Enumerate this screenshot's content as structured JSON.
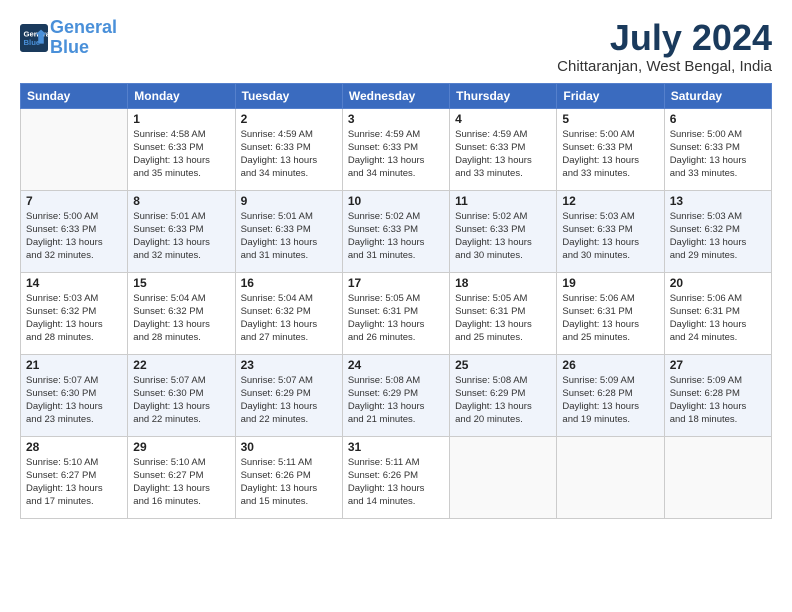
{
  "header": {
    "logo_line1": "General",
    "logo_line2": "Blue",
    "title": "July 2024",
    "location": "Chittaranjan, West Bengal, India"
  },
  "days_of_week": [
    "Sunday",
    "Monday",
    "Tuesday",
    "Wednesday",
    "Thursday",
    "Friday",
    "Saturday"
  ],
  "weeks": [
    [
      {
        "day": "",
        "info": ""
      },
      {
        "day": "1",
        "info": "Sunrise: 4:58 AM\nSunset: 6:33 PM\nDaylight: 13 hours\nand 35 minutes."
      },
      {
        "day": "2",
        "info": "Sunrise: 4:59 AM\nSunset: 6:33 PM\nDaylight: 13 hours\nand 34 minutes."
      },
      {
        "day": "3",
        "info": "Sunrise: 4:59 AM\nSunset: 6:33 PM\nDaylight: 13 hours\nand 34 minutes."
      },
      {
        "day": "4",
        "info": "Sunrise: 4:59 AM\nSunset: 6:33 PM\nDaylight: 13 hours\nand 33 minutes."
      },
      {
        "day": "5",
        "info": "Sunrise: 5:00 AM\nSunset: 6:33 PM\nDaylight: 13 hours\nand 33 minutes."
      },
      {
        "day": "6",
        "info": "Sunrise: 5:00 AM\nSunset: 6:33 PM\nDaylight: 13 hours\nand 33 minutes."
      }
    ],
    [
      {
        "day": "7",
        "info": "Sunrise: 5:00 AM\nSunset: 6:33 PM\nDaylight: 13 hours\nand 32 minutes."
      },
      {
        "day": "8",
        "info": "Sunrise: 5:01 AM\nSunset: 6:33 PM\nDaylight: 13 hours\nand 32 minutes."
      },
      {
        "day": "9",
        "info": "Sunrise: 5:01 AM\nSunset: 6:33 PM\nDaylight: 13 hours\nand 31 minutes."
      },
      {
        "day": "10",
        "info": "Sunrise: 5:02 AM\nSunset: 6:33 PM\nDaylight: 13 hours\nand 31 minutes."
      },
      {
        "day": "11",
        "info": "Sunrise: 5:02 AM\nSunset: 6:33 PM\nDaylight: 13 hours\nand 30 minutes."
      },
      {
        "day": "12",
        "info": "Sunrise: 5:03 AM\nSunset: 6:33 PM\nDaylight: 13 hours\nand 30 minutes."
      },
      {
        "day": "13",
        "info": "Sunrise: 5:03 AM\nSunset: 6:32 PM\nDaylight: 13 hours\nand 29 minutes."
      }
    ],
    [
      {
        "day": "14",
        "info": "Sunrise: 5:03 AM\nSunset: 6:32 PM\nDaylight: 13 hours\nand 28 minutes."
      },
      {
        "day": "15",
        "info": "Sunrise: 5:04 AM\nSunset: 6:32 PM\nDaylight: 13 hours\nand 28 minutes."
      },
      {
        "day": "16",
        "info": "Sunrise: 5:04 AM\nSunset: 6:32 PM\nDaylight: 13 hours\nand 27 minutes."
      },
      {
        "day": "17",
        "info": "Sunrise: 5:05 AM\nSunset: 6:31 PM\nDaylight: 13 hours\nand 26 minutes."
      },
      {
        "day": "18",
        "info": "Sunrise: 5:05 AM\nSunset: 6:31 PM\nDaylight: 13 hours\nand 25 minutes."
      },
      {
        "day": "19",
        "info": "Sunrise: 5:06 AM\nSunset: 6:31 PM\nDaylight: 13 hours\nand 25 minutes."
      },
      {
        "day": "20",
        "info": "Sunrise: 5:06 AM\nSunset: 6:31 PM\nDaylight: 13 hours\nand 24 minutes."
      }
    ],
    [
      {
        "day": "21",
        "info": "Sunrise: 5:07 AM\nSunset: 6:30 PM\nDaylight: 13 hours\nand 23 minutes."
      },
      {
        "day": "22",
        "info": "Sunrise: 5:07 AM\nSunset: 6:30 PM\nDaylight: 13 hours\nand 22 minutes."
      },
      {
        "day": "23",
        "info": "Sunrise: 5:07 AM\nSunset: 6:29 PM\nDaylight: 13 hours\nand 22 minutes."
      },
      {
        "day": "24",
        "info": "Sunrise: 5:08 AM\nSunset: 6:29 PM\nDaylight: 13 hours\nand 21 minutes."
      },
      {
        "day": "25",
        "info": "Sunrise: 5:08 AM\nSunset: 6:29 PM\nDaylight: 13 hours\nand 20 minutes."
      },
      {
        "day": "26",
        "info": "Sunrise: 5:09 AM\nSunset: 6:28 PM\nDaylight: 13 hours\nand 19 minutes."
      },
      {
        "day": "27",
        "info": "Sunrise: 5:09 AM\nSunset: 6:28 PM\nDaylight: 13 hours\nand 18 minutes."
      }
    ],
    [
      {
        "day": "28",
        "info": "Sunrise: 5:10 AM\nSunset: 6:27 PM\nDaylight: 13 hours\nand 17 minutes."
      },
      {
        "day": "29",
        "info": "Sunrise: 5:10 AM\nSunset: 6:27 PM\nDaylight: 13 hours\nand 16 minutes."
      },
      {
        "day": "30",
        "info": "Sunrise: 5:11 AM\nSunset: 6:26 PM\nDaylight: 13 hours\nand 15 minutes."
      },
      {
        "day": "31",
        "info": "Sunrise: 5:11 AM\nSunset: 6:26 PM\nDaylight: 13 hours\nand 14 minutes."
      },
      {
        "day": "",
        "info": ""
      },
      {
        "day": "",
        "info": ""
      },
      {
        "day": "",
        "info": ""
      }
    ]
  ]
}
